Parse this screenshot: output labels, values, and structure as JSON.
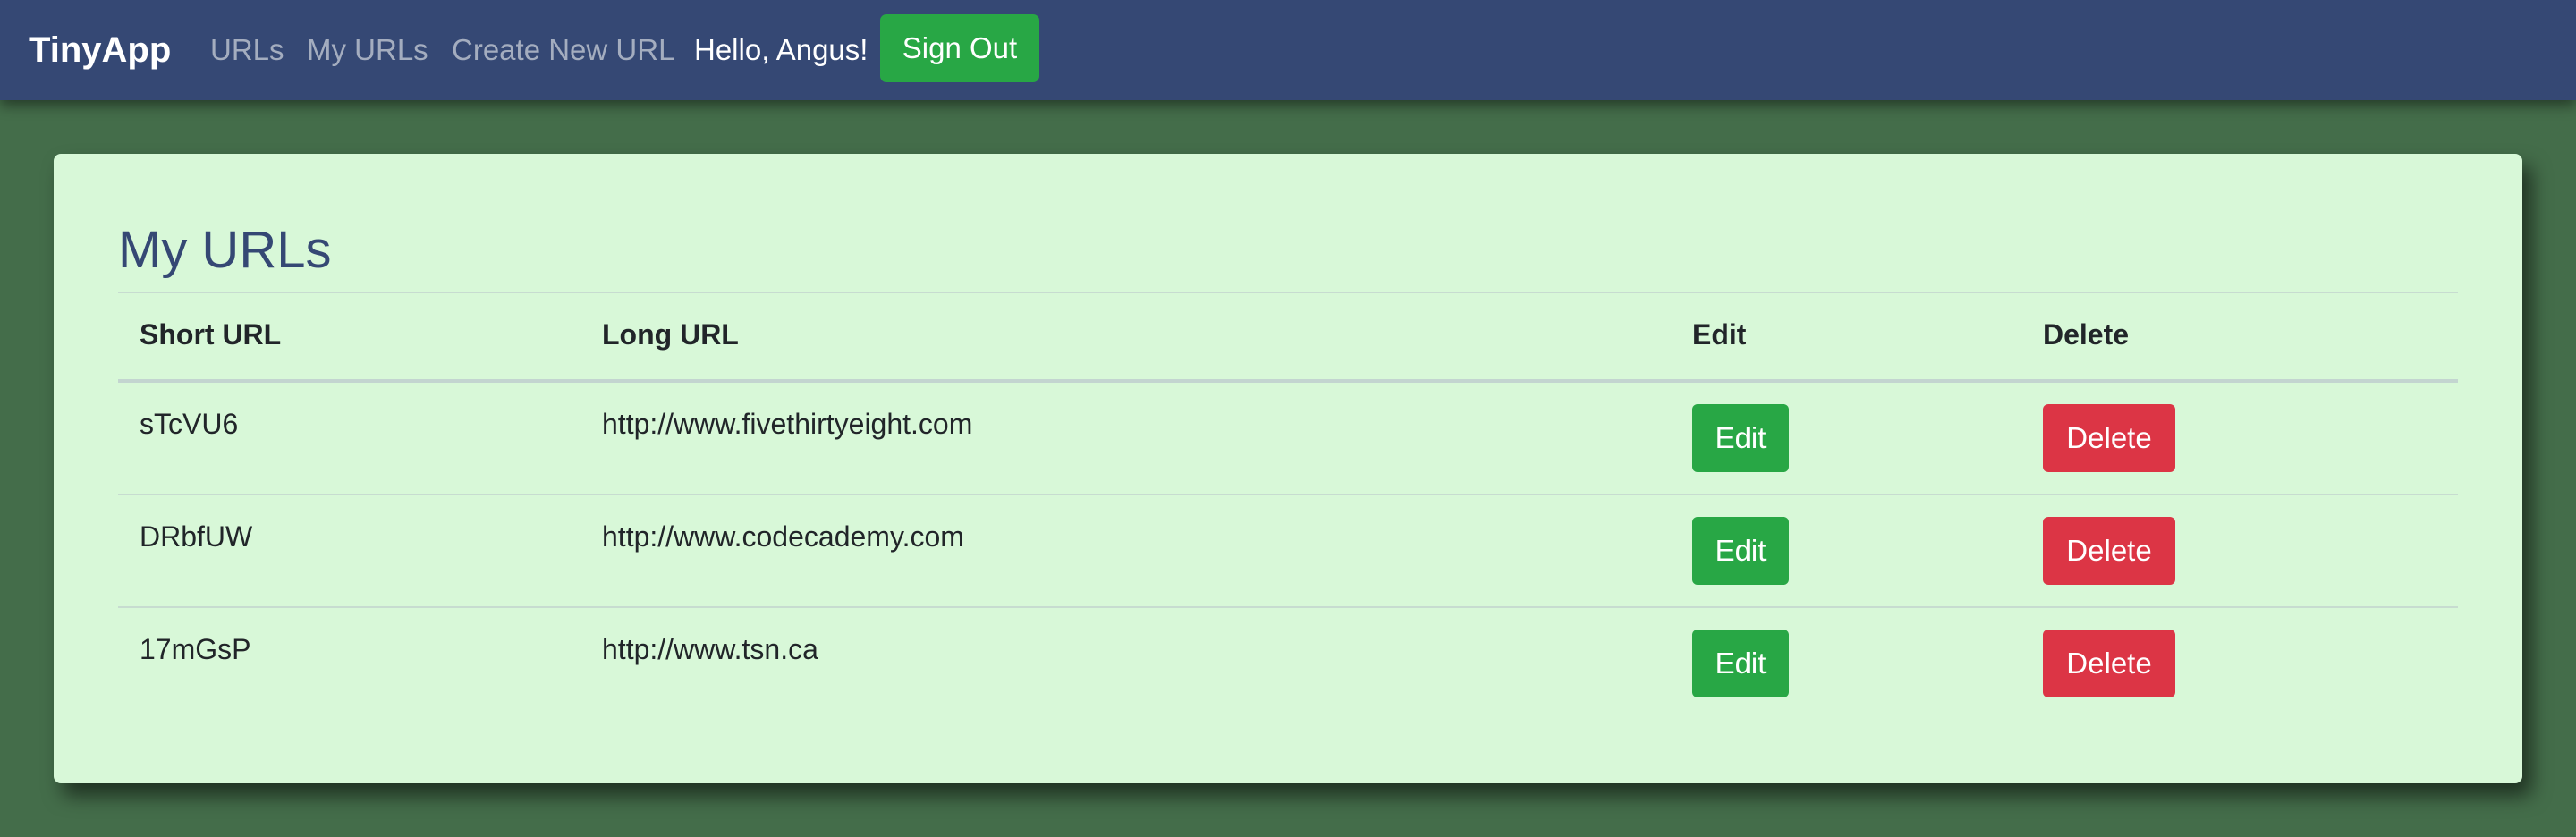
{
  "nav": {
    "brand": "TinyApp",
    "links": [
      {
        "label": "URLs"
      },
      {
        "label": "My URLs"
      },
      {
        "label": "Create New URL"
      }
    ],
    "greeting": "Hello, Angus!",
    "sign_out_label": "Sign Out"
  },
  "page": {
    "title": "My URLs"
  },
  "table": {
    "headers": {
      "short_url": "Short URL",
      "long_url": "Long URL",
      "edit": "Edit",
      "delete": "Delete"
    },
    "rows": [
      {
        "short_url": "sTcVU6",
        "long_url": "http://www.fivethirtyeight.com",
        "edit_label": "Edit",
        "delete_label": "Delete"
      },
      {
        "short_url": "DRbfUW",
        "long_url": "http://www.codecademy.com",
        "edit_label": "Edit",
        "delete_label": "Delete"
      },
      {
        "short_url": "17mGsP",
        "long_url": "http://www.tsn.ca",
        "edit_label": "Edit",
        "delete_label": "Delete"
      }
    ]
  },
  "colors": {
    "navbar": "#354874",
    "background": "#446d4a",
    "card": "#d8f8d8",
    "success": "#28a745",
    "danger": "#dc3545",
    "title": "#354874"
  }
}
